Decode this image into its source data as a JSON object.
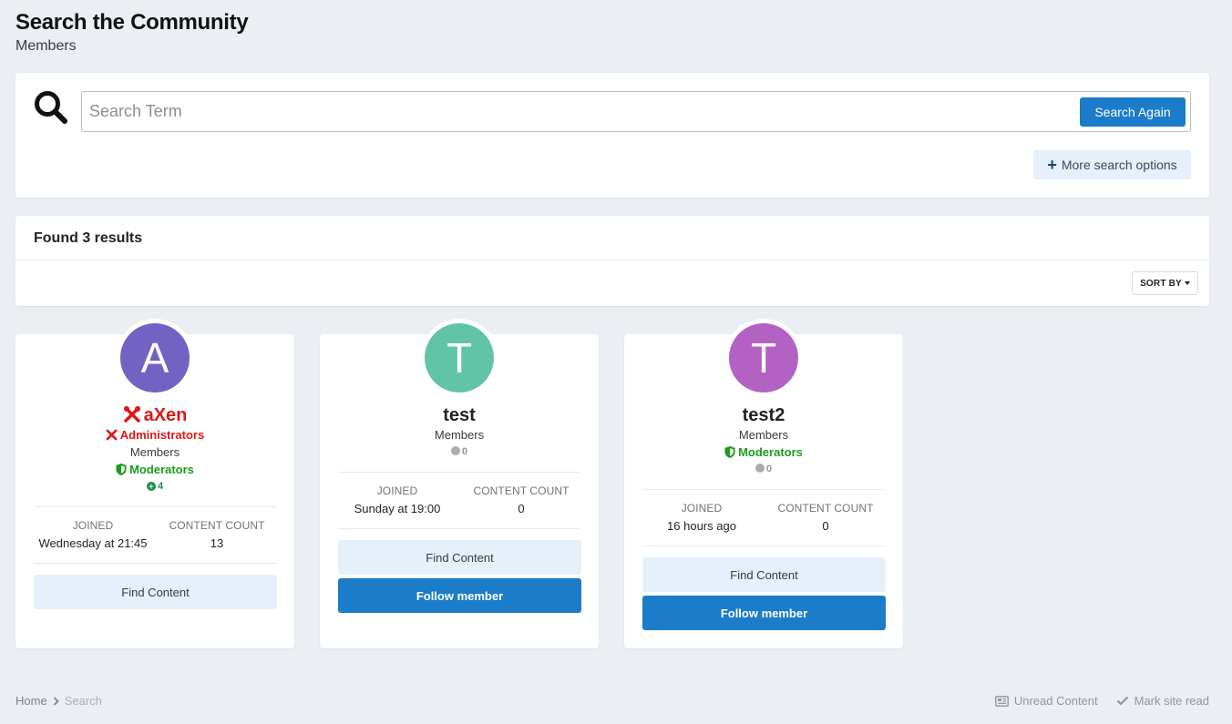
{
  "header": {
    "title": "Search the Community",
    "subtitle": "Members"
  },
  "search": {
    "placeholder": "Search Term",
    "value": "",
    "submit_label": "Search Again",
    "more_options_label": "More search options"
  },
  "results": {
    "title": "Found 3 results",
    "sort_label": "SORT BY"
  },
  "members": [
    {
      "initial": "A",
      "avatar_color": "#7162c4",
      "name": "aXen",
      "groups": {
        "admin": "Administrators",
        "members": "Members",
        "moderators": "Moderators"
      },
      "reputation": "4",
      "joined_label": "JOINED",
      "joined": "Wednesday at 21:45",
      "count_label": "CONTENT COUNT",
      "content_count": "13",
      "find_label": "Find Content"
    },
    {
      "initial": "T",
      "avatar_color": "#62c4a6",
      "name": "test",
      "groups": {
        "members": "Members"
      },
      "reputation": "0",
      "joined_label": "JOINED",
      "joined": "Sunday at 19:00",
      "count_label": "CONTENT COUNT",
      "content_count": "0",
      "find_label": "Find Content",
      "follow_label": "Follow member"
    },
    {
      "initial": "T",
      "avatar_color": "#b362c4",
      "name": "test2",
      "groups": {
        "members": "Members",
        "moderators": "Moderators"
      },
      "reputation": "0",
      "joined_label": "JOINED",
      "joined": "16 hours ago",
      "count_label": "CONTENT COUNT",
      "content_count": "0",
      "find_label": "Find Content",
      "follow_label": "Follow member"
    }
  ],
  "breadcrumb": {
    "home": "Home",
    "current": "Search"
  },
  "footer": {
    "unread": "Unread Content",
    "mark_read": "Mark site read"
  },
  "colors": {
    "accent": "#1b7cc9",
    "admin": "#e01616",
    "moderator": "#1c9c1c",
    "background": "#ebeef2"
  },
  "icons": [
    "search-icon",
    "plus-icon",
    "caret-down-icon",
    "wrench-icon",
    "shield-icon",
    "reputation-plus-icon",
    "reputation-neutral-icon",
    "chevron-right-icon",
    "newspaper-icon",
    "checkmark-icon"
  ]
}
